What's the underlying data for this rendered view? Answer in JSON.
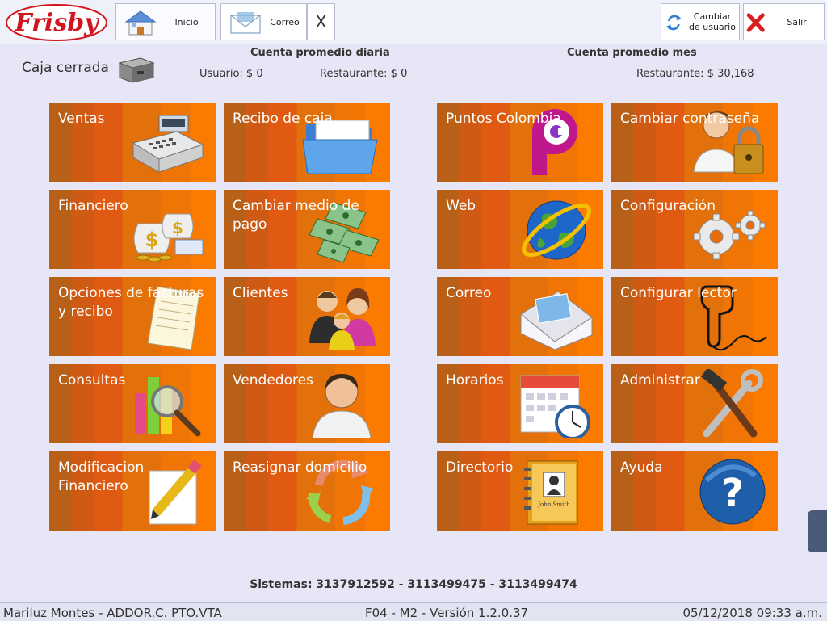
{
  "brand": {
    "logo_text": "Frisby"
  },
  "toolbar": {
    "tabs": [
      {
        "label": "Inicio",
        "icon": "home-icon"
      },
      {
        "label": "Correo",
        "icon": "mail-icon"
      }
    ],
    "close_label": "X",
    "change_user_label": "Cambiar de usuario",
    "exit_label": "Salir"
  },
  "status": {
    "cash_status": "Caja cerrada",
    "daily_title": "Cuenta promedio diaria",
    "daily_user": "Usuario: $ 0",
    "daily_restaurant": "Restaurante: $ 0",
    "monthly_title": "Cuenta promedio mes",
    "monthly_restaurant": "Restaurante: $ 30,168"
  },
  "tiles": [
    {
      "label": "Ventas",
      "icon": "cash-register-icon"
    },
    {
      "label": "Recibo de caja",
      "icon": "folder-icon"
    },
    {
      "label": "Puntos Colombia",
      "icon": "puntos-colombia-logo-icon"
    },
    {
      "label": "Cambiar contraseña",
      "icon": "user-lock-icon"
    },
    {
      "label": "Financiero",
      "icon": "money-bags-icon"
    },
    {
      "label": "Cambiar medio de pago",
      "icon": "banknotes-icon"
    },
    {
      "label": "Web",
      "icon": "globe-icon"
    },
    {
      "label": "Configuración",
      "icon": "gears-icon"
    },
    {
      "label": "Opciones de facturas y recibo",
      "icon": "invoice-icon"
    },
    {
      "label": "Clientes",
      "icon": "people-icon"
    },
    {
      "label": "Correo",
      "icon": "envelope-icon"
    },
    {
      "label": "Configurar lector",
      "icon": "barcode-scanner-icon"
    },
    {
      "label": "Consultas",
      "icon": "chart-magnifier-icon"
    },
    {
      "label": "Vendedores",
      "icon": "salesperson-icon"
    },
    {
      "label": "Horarios",
      "icon": "calendar-clock-icon"
    },
    {
      "label": "Administrar",
      "icon": "tools-icon"
    },
    {
      "label": "Modificacion Financiero",
      "icon": "pencil-document-icon"
    },
    {
      "label": "Reasignar domicilio",
      "icon": "refresh-arrows-icon"
    },
    {
      "label": "Directorio",
      "icon": "address-book-icon"
    },
    {
      "label": "Ayuda",
      "icon": "help-icon"
    }
  ],
  "footer": {
    "support_phones": "Sistemas: 3137912592 - 3113499475 - 3113499474",
    "user_info": "Mariluz Montes - ADDOR.C. PTO.VTA",
    "version_info": "F04 - M2  -  Versión 1.2.0.37",
    "datetime": "05/12/2018 09:33 a.m."
  },
  "colors": {
    "tile_orange": "#f07505",
    "brand_red": "#d2141e",
    "background": "#e6e6f6"
  }
}
